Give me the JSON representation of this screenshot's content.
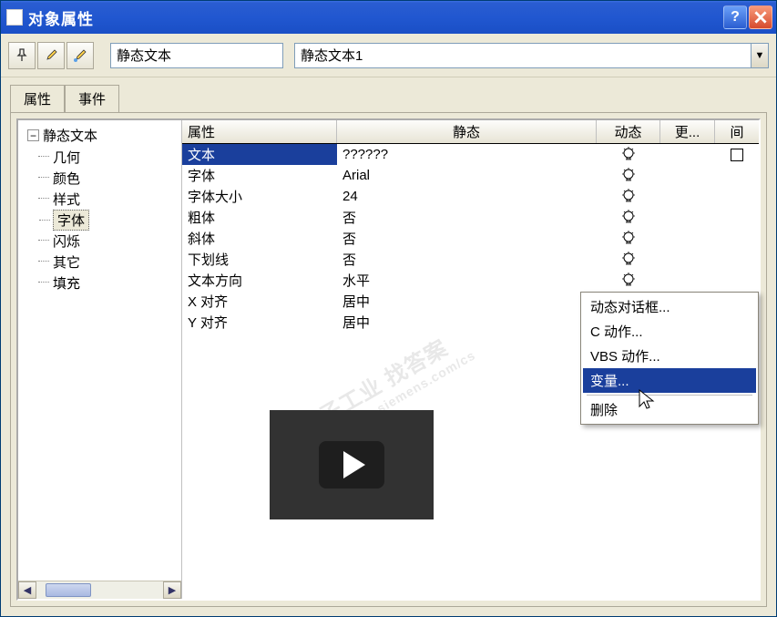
{
  "titlebar": {
    "title": "对象属性"
  },
  "toolbar": {
    "name_field": "静态文本",
    "combo_value": "静态文本1"
  },
  "tabs": {
    "tab1": "属性",
    "tab2": "事件"
  },
  "tree": {
    "root": "静态文本",
    "items": [
      "几何",
      "颜色",
      "样式",
      "字体",
      "闪烁",
      "其它",
      "填充"
    ],
    "selected_index": 3
  },
  "grid": {
    "headers": {
      "prop": "属性",
      "static": "静态",
      "dyn": "动态",
      "more": "更...",
      "gap": "间"
    },
    "rows": [
      {
        "prop": "文本",
        "static": "??????",
        "dyn": true,
        "more": "",
        "gap": true,
        "selected": true
      },
      {
        "prop": "字体",
        "static": "Arial",
        "dyn": true,
        "more": "",
        "gap": false
      },
      {
        "prop": "字体大小",
        "static": "24",
        "dyn": true,
        "more": "",
        "gap": false
      },
      {
        "prop": "粗体",
        "static": "否",
        "dyn": true,
        "more": "",
        "gap": false
      },
      {
        "prop": "斜体",
        "static": "否",
        "dyn": true,
        "more": "",
        "gap": false
      },
      {
        "prop": "下划线",
        "static": "否",
        "dyn": true,
        "more": "",
        "gap": false
      },
      {
        "prop": "文本方向",
        "static": "水平",
        "dyn": true,
        "more": "",
        "gap": false
      },
      {
        "prop": "X 对齐",
        "static": "居中",
        "dyn": true,
        "more": "",
        "gap": true
      },
      {
        "prop": "Y 对齐",
        "static": "居中",
        "dyn": true,
        "more": "",
        "gap": true
      }
    ]
  },
  "context_menu": {
    "items": [
      "动态对话框...",
      "C 动作...",
      "VBS 动作...",
      "变量...",
      "删除"
    ],
    "highlight_index": 3
  },
  "watermark": {
    "line1": "西门子工业  找答案",
    "line2": "support.industry.siemens.com/cs"
  }
}
